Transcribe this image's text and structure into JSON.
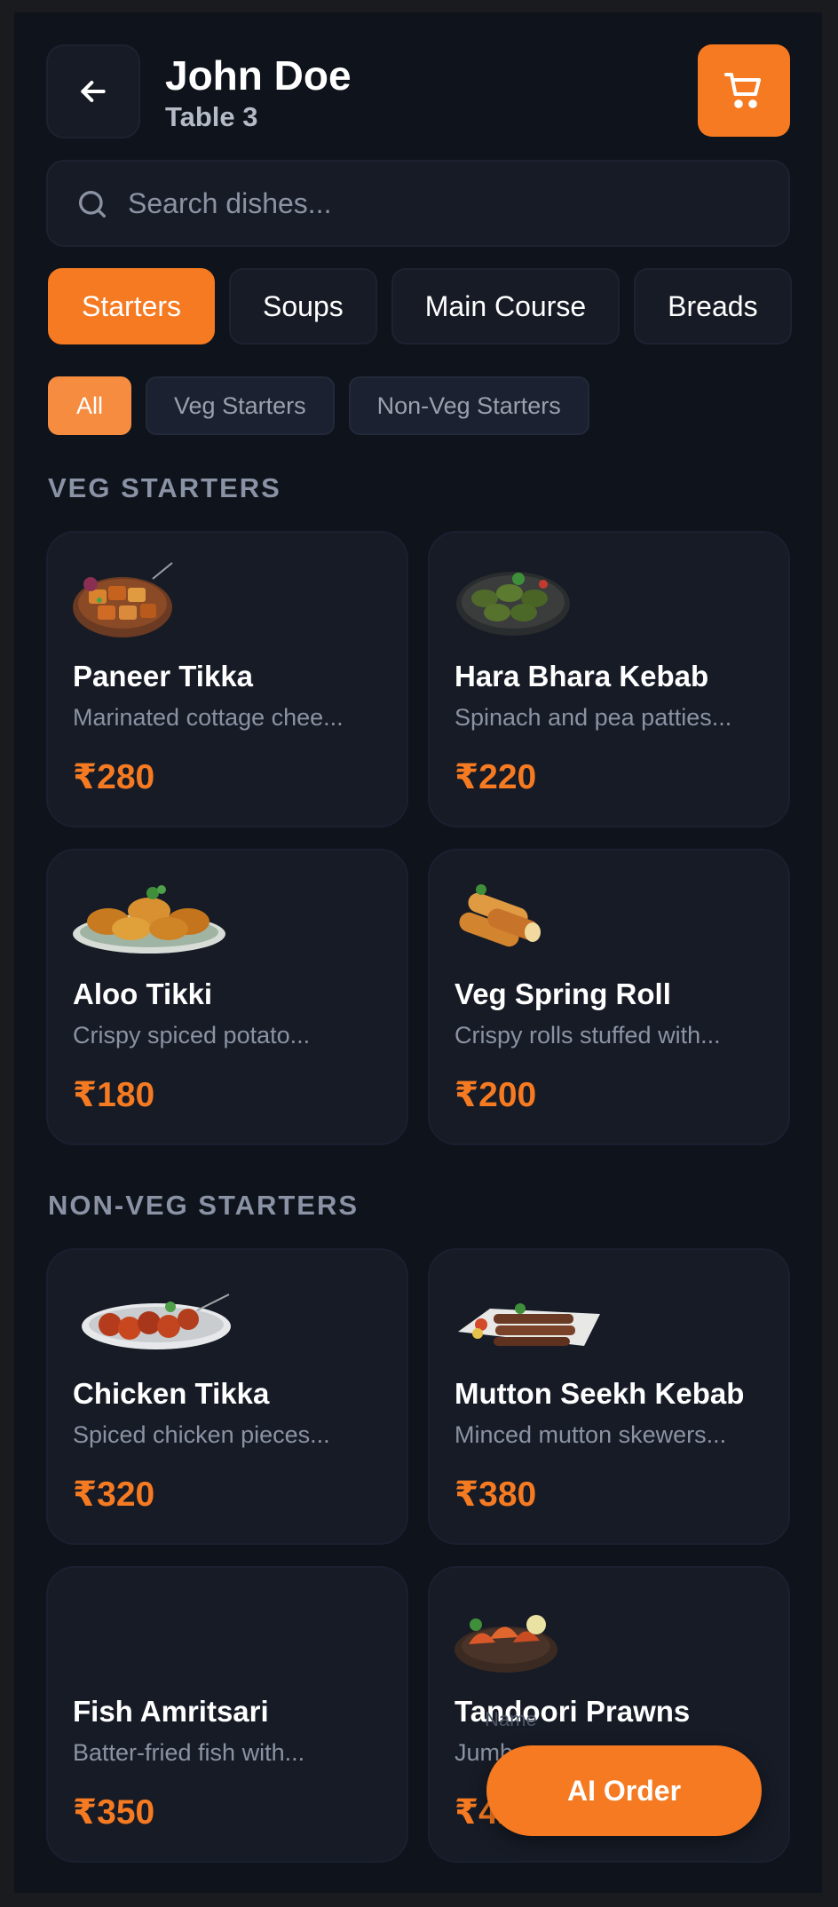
{
  "header": {
    "title": "John Doe",
    "subtitle": "Table 3"
  },
  "search": {
    "placeholder": "Search dishes..."
  },
  "tabs": [
    {
      "label": "Starters",
      "active": true
    },
    {
      "label": "Soups"
    },
    {
      "label": "Main Course"
    },
    {
      "label": "Breads"
    }
  ],
  "chips": [
    {
      "label": "All",
      "active": true
    },
    {
      "label": "Veg Starters"
    },
    {
      "label": "Non-Veg Starters"
    }
  ],
  "sections": [
    {
      "title": "VEG STARTERS",
      "items": [
        {
          "name": "Paneer Tikka",
          "desc": "Marinated cottage chee...",
          "price": "₹280",
          "icon": "paneer-tikka-image"
        },
        {
          "name": "Hara Bhara Kebab",
          "desc": "Spinach and pea patties...",
          "price": "₹220",
          "icon": "hara-bhara-kebab-image"
        },
        {
          "name": "Aloo Tikki",
          "desc": "Crispy spiced potato...",
          "price": "₹180",
          "icon": "aloo-tikki-image"
        },
        {
          "name": "Veg Spring Roll",
          "desc": "Crispy rolls stuffed with...",
          "price": "₹200",
          "icon": "spring-roll-image"
        }
      ]
    },
    {
      "title": "NON-VEG STARTERS",
      "items": [
        {
          "name": "Chicken Tikka",
          "desc": "Spiced chicken pieces...",
          "price": "₹320",
          "icon": "chicken-tikka-image"
        },
        {
          "name": "Mutton Seekh Kebab",
          "desc": "Minced mutton skewers...",
          "price": "₹380",
          "icon": "seekh-kebab-image"
        },
        {
          "name": "Fish Amritsari",
          "desc": "Batter-fried fish with...",
          "price": "₹350",
          "icon": ""
        },
        {
          "name": "Tandoori Prawns",
          "desc": "Jumbo prawns...",
          "price": "₹420",
          "icon": "tandoori-prawns-image"
        }
      ]
    }
  ],
  "fab": {
    "label": "AI Order",
    "hint": "Name"
  },
  "colors": {
    "accent": "#f57a21",
    "background": "#0f131b",
    "card": "#161b26"
  }
}
